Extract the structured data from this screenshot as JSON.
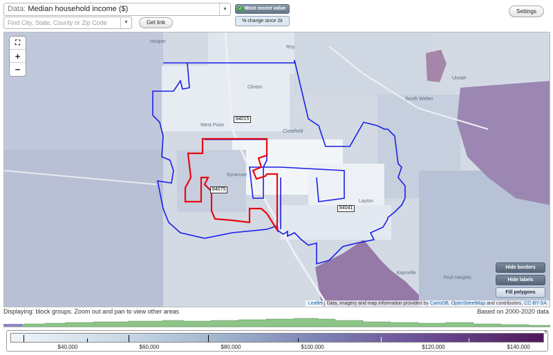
{
  "data_select": {
    "label": "Data:",
    "value": "Median household income ($)"
  },
  "find": {
    "placeholder": "Find City, State, County or Zip Code"
  },
  "buttons": {
    "get_link": "Get link",
    "most_recent": "Most recent value",
    "pct_change": "% change since 2k",
    "settings": "Settings"
  },
  "map_buttons": {
    "hide_borders": "Hide borders",
    "hide_labels": "Hide labels",
    "fill_polygons": "Fill polygons"
  },
  "zip_labels": [
    "84015",
    "84075",
    "84041"
  ],
  "places": [
    "Hooper",
    "Roy",
    "Uintah",
    "Clinton",
    "South Weber",
    "West Point",
    "Clearfield",
    "Syracuse",
    "Layton",
    "Kaysville",
    "Fruit Heights"
  ],
  "attribution": {
    "leaflet": "Leaflet",
    "text1": " | Data, imagery and map information provided by ",
    "cartodb": "CartoDB",
    "sep": ", ",
    "osm": "OpenStreetMap",
    "text2": " and contributors, ",
    "license": "CC-BY-SA"
  },
  "status": {
    "left": "Displaying: block groups. Zoom out and pan to view other areas",
    "right": "Based on 2000-2020 data"
  },
  "legend": {
    "labels": [
      "$40,000",
      "$60,000",
      "$80,000",
      "$100,000",
      "$120,000",
      "$140,000"
    ],
    "question": "?"
  },
  "colors": {
    "accent_red": "#e8080f",
    "border_blue": "#1a1ee6",
    "histogram_green": "#8ec488"
  }
}
